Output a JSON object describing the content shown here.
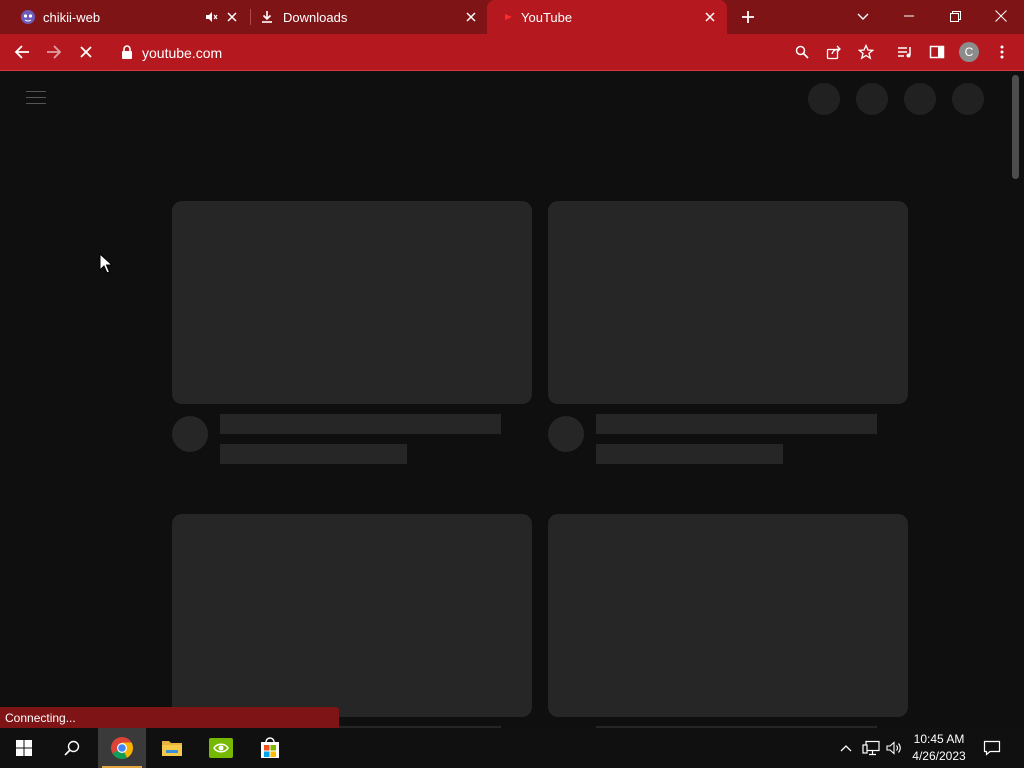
{
  "browser": {
    "tabs": [
      {
        "title": "chikii-web",
        "favicon": "chikii-mascot-icon",
        "muted_indicator": "speaker-muted-icon",
        "active": false
      },
      {
        "title": "Downloads",
        "favicon": "download-icon",
        "active": false
      },
      {
        "title": "YouTube",
        "favicon": "youtube-icon",
        "active": true
      }
    ],
    "new_tab_icon": "plus-icon",
    "tab_search_icon": "chevron-down-icon",
    "window_controls": [
      "minimize-icon",
      "restore-icon",
      "close-icon"
    ],
    "address": {
      "url": "youtube.com"
    },
    "profile_initial": "C",
    "status_text": "Connecting..."
  },
  "colors": {
    "tabstrip": "#7f1416",
    "toolbar": "#b5181e",
    "page_bg": "#0f0f0f",
    "skeleton": "#262626"
  },
  "taskbar": {
    "apps": [
      "windows-start-icon",
      "search-icon",
      "chrome-icon",
      "file-explorer-icon",
      "nvidia-icon",
      "microsoft-store-icon"
    ],
    "time": "10:45 AM",
    "date": "4/26/2023"
  }
}
